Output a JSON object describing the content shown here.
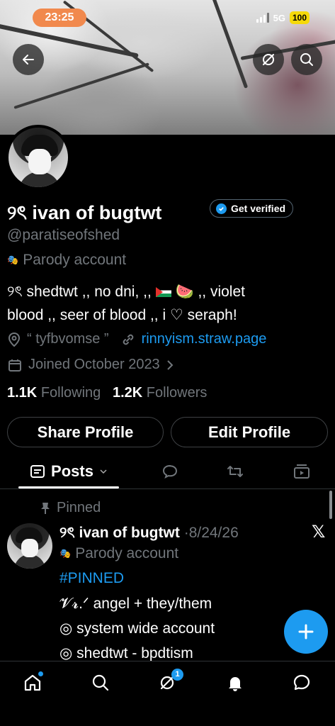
{
  "status_bar": {
    "time": "23:25",
    "network": "5G",
    "network_suffix": "UC",
    "battery": "100"
  },
  "profile": {
    "display_name": "୨ৎ ivan of bugtwt",
    "get_verified_label": "Get verified",
    "handle": "@paratiseofshed",
    "parody_label": "Parody account",
    "bio_line1_a": "୨ৎ shedtwt ,, no dni, ,, ",
    "bio_line1_b": "🍉 ,, violet",
    "bio_line2": "blood ,, seer of blood ,, i ♡ seraph!",
    "location": "“ tyfbvomse ”",
    "website": "rinnyism.straw.page",
    "joined": "Joined October 2023",
    "following_count": "1.1K",
    "following_label": "Following",
    "followers_count": "1.2K",
    "followers_label": "Followers",
    "share_label": "Share Profile",
    "edit_label": "Edit Profile"
  },
  "tabs": {
    "posts_label": "Posts"
  },
  "pinned_post": {
    "pinned_label": "Pinned",
    "author": "୨ৎ ivan of bugtwt",
    "date": "8/24/26",
    "parody_label": "Parody account",
    "hashtag": "#PINNED",
    "line1": "𝓥𝓻.ᐟ angel + they/them",
    "line2": "◎ system wide account",
    "line3": "◎ shedtwt - bpdtism"
  },
  "bottom_nav": {
    "notifications_badge": "1"
  },
  "colors": {
    "accent": "#1d9bf0",
    "status_time_bg": "#f1894d",
    "battery": "#f5d90a"
  }
}
